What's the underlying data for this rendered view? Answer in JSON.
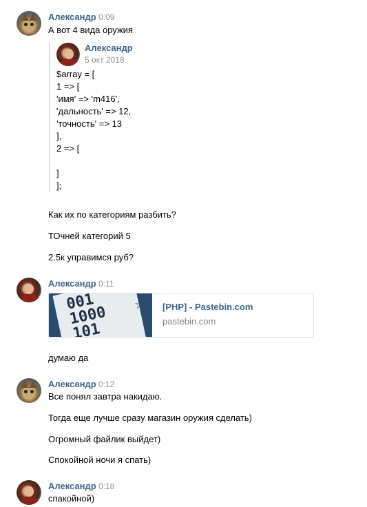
{
  "messages": [
    {
      "author": "Александр",
      "time": "0:09",
      "lines": [
        "А вот 4 вида оружия"
      ]
    },
    {
      "author": "Александр",
      "time": "0:11"
    },
    {
      "author": "Александр",
      "time": "0:12",
      "lines": [
        "Все понял завтра накидаю.",
        "Тогда еще лучше сразу магазин оружия сделать)",
        "Огромный файлик выйдет)",
        "Спокойной ночи я спать)"
      ]
    },
    {
      "author": "Александр",
      "time": "0:18",
      "lines": [
        "спакойной)"
      ]
    }
  ],
  "forward": {
    "author": "Александр",
    "date": "5 окт 2018",
    "code": [
      "$array = [",
      "1 => [",
      "'имя' => 'm416',",
      "'дальность' => 12,",
      "'точность' => 13",
      "],",
      "2 => [",
      "",
      "]",
      "];"
    ]
  },
  "after_forward": [
    "Как их по категориям разбить?",
    "ТОчней категорий 5",
    "2.5к управимся руб?"
  ],
  "link": {
    "title": "[PHP] - Pastebin.com",
    "domain": "pastebin.com",
    "thumb_digits": "001\n1000\n101",
    "star_icon": "star-icon"
  },
  "after_link": [
    "думаю да"
  ],
  "colors": {
    "author": "#42648b",
    "time": "#939393",
    "quote_bar": "#dae1e8"
  }
}
